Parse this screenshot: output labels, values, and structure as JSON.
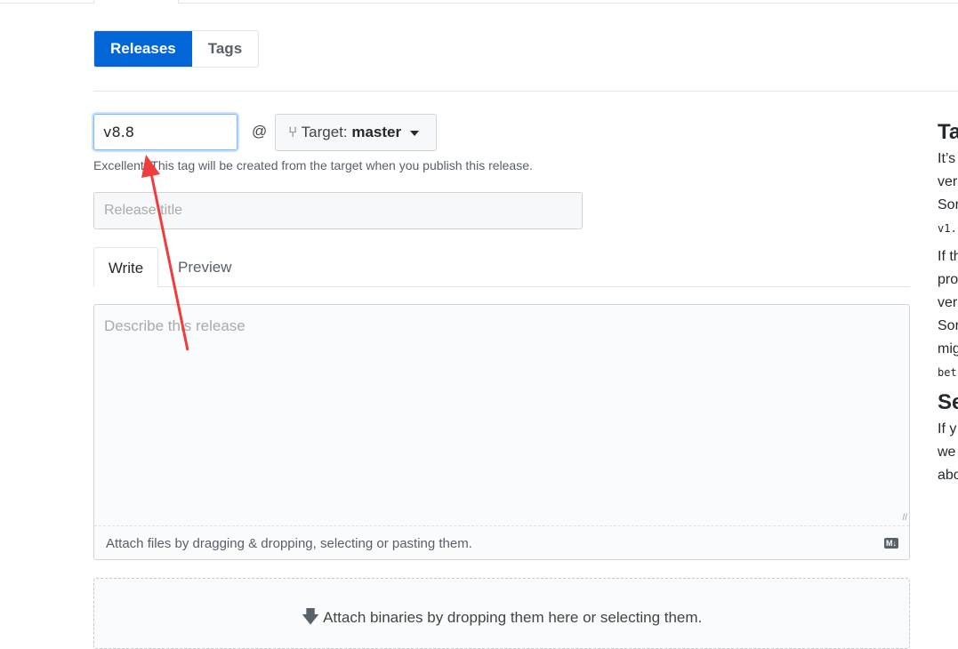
{
  "nav": {
    "releases": "Releases",
    "tags": "Tags"
  },
  "form": {
    "tag_value": "v8.8",
    "at": "@",
    "target_label": "Target:",
    "target_branch": "master",
    "tag_note": "Excellent! This tag will be created from the target when you publish this release.",
    "title_placeholder": "Release title",
    "tab_write": "Write",
    "tab_preview": "Preview",
    "body_placeholder": "Describe this release",
    "attach_files": "Attach files by dragging & dropping, selecting or pasting them.",
    "markdown_badge": "M↓",
    "attach_binaries": "Attach binaries by dropping them here or selecting them."
  },
  "sidebar": {
    "heading1": "Ta",
    "p1": [
      "It’s",
      "ver",
      "Sor"
    ],
    "code1": "v1.",
    "p2": [
      "If th",
      "pro",
      "ver",
      "Sor",
      "mig"
    ],
    "code2": "bet",
    "heading2": "Se",
    "p3": [
      "If y",
      "we",
      "abo"
    ]
  },
  "colors": {
    "primary": "#0366d6",
    "annotation_arrow": "#f03c3c"
  }
}
